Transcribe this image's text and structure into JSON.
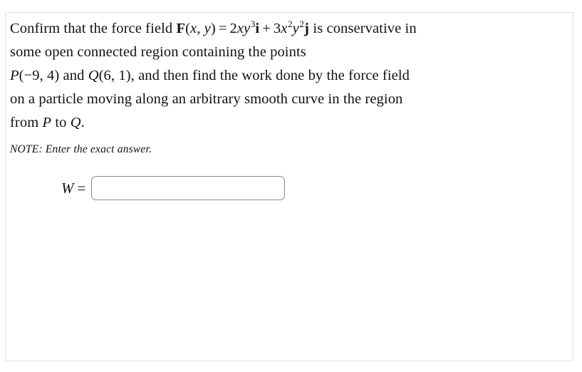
{
  "problem": {
    "line1": {
      "pre": "Confirm that the force field ",
      "vector_symbol": "F",
      "args_open": "(",
      "var_x": "x",
      "comma": ", ",
      "var_y": "y",
      "args_close": ")",
      "equals": "=",
      "term1_coeff": "2",
      "term1_x": "x",
      "term1_y": "y",
      "term1_exp": "3",
      "term1_unit": "i",
      "plus": "+",
      "term2_coeff": "3",
      "term2_x": "x",
      "term2_x_exp": "2",
      "term2_y": "y",
      "term2_y_exp": "2",
      "term2_unit": "j",
      "post": " is conservative in"
    },
    "line2": "some open connected region containing the points",
    "line3": {
      "point_p": "P",
      "p_open": "(",
      "p_x": "−9",
      "p_comma": ", ",
      "p_y": "4",
      "p_close": ")",
      "and": " and ",
      "point_q": "Q",
      "q_open": "(",
      "q_x": "6",
      "q_comma": ", ",
      "q_y": "1",
      "q_close": ")",
      "tail": ", and then find the work done by the force field"
    },
    "line4": "on a particle moving along an arbitrary smooth curve in the region",
    "line5": {
      "pre": "from ",
      "point_p": "P",
      "mid": " to ",
      "point_q": "Q",
      "period": "."
    },
    "note": "NOTE: Enter the exact answer."
  },
  "answer": {
    "label_variable": "W",
    "label_equals": "=",
    "value": "",
    "placeholder": ""
  },
  "colors": {
    "card_border": "#e2e2e2",
    "input_border": "#8a8a8a",
    "text": "#111111",
    "background": "#ffffff"
  }
}
